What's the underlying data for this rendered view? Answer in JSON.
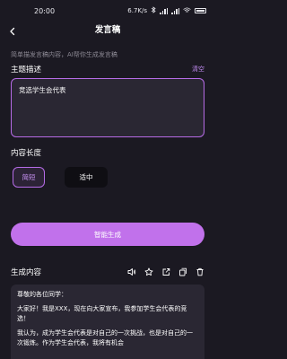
{
  "status_bar": {
    "time": "20:00",
    "network_speed": "6.7K/s",
    "icons": [
      "bluetooth-icon",
      "hd-icon",
      "signal-icon",
      "signal-icon",
      "wifi-icon",
      "battery-icon"
    ]
  },
  "header": {
    "title": "发言稿",
    "back_icon": "chevron-left-icon"
  },
  "hint": "简单描发言稿内容，AI帮你生成发言稿",
  "topic": {
    "title": "主题描述",
    "clear_label": "清空",
    "value": "竞选学生会代表"
  },
  "length": {
    "title": "内容长度",
    "options": [
      {
        "label": "简短",
        "selected": true
      },
      {
        "label": "适中",
        "selected": false
      }
    ]
  },
  "generate_button": "智能生成",
  "result": {
    "title": "生成内容",
    "toolbar_icons": [
      "speaker-icon",
      "star-icon",
      "share-icon",
      "copy-icon",
      "delete-icon"
    ],
    "paragraphs": [
      "尊敬的各位同学：",
      "大家好！我是XXX，现在向大家宣布，我参加学生会代表的竞选！",
      "我认为，成为学生会代表是对自己的一次挑战，也是对自己的一次锻炼。作为学生会代表，我将有机会"
    ]
  },
  "colors": {
    "background": "#1b1922",
    "accent": "#c171eb",
    "box": "#2a2733"
  }
}
